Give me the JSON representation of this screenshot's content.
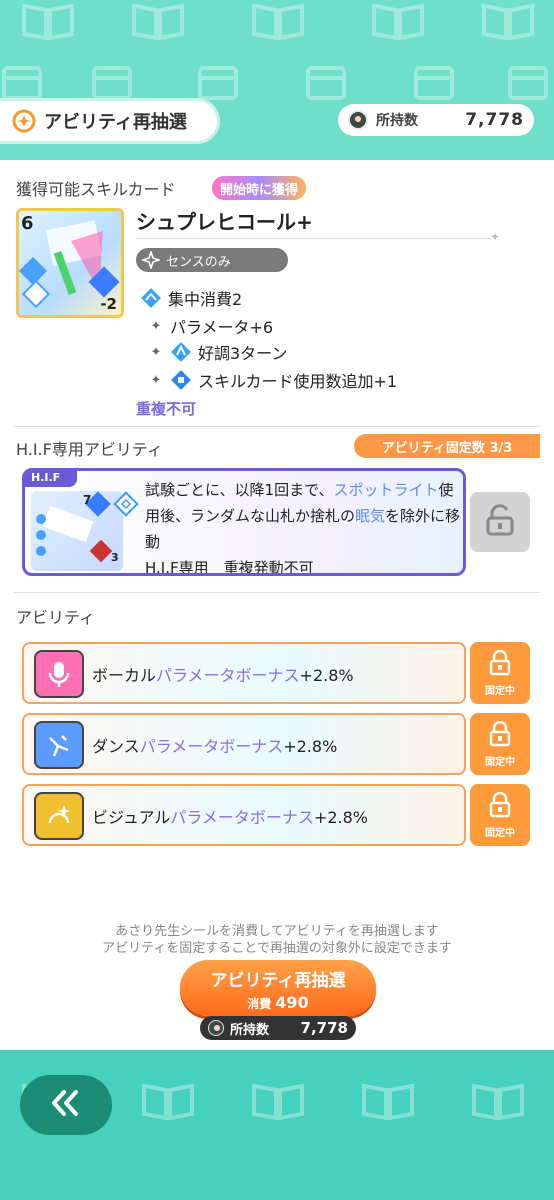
{
  "header": {
    "title": "アビリティ再抽選",
    "owned_label": "所持数",
    "owned_value": "7,778"
  },
  "skill_card": {
    "section_title": "獲得可能スキルカード",
    "badge": "開始時に獲得",
    "card_cost": "6",
    "card_modifier": "-2",
    "name": "シュプレヒコール+",
    "restriction": "センスのみ",
    "effects": [
      {
        "icon": "focus-cost-icon",
        "text": "集中消費2"
      },
      {
        "icon": "plus-icon",
        "text": "パラメータ+6"
      },
      {
        "icon": "good-condition-icon",
        "text": "好調3ターン"
      },
      {
        "icon": "card-use-icon",
        "text": "スキルカード使用数追加+1"
      }
    ],
    "no_duplicate": "重複不可"
  },
  "hif": {
    "section_title": "H.I.F専用アビリティ",
    "fixed_count": "アビリティ固定数 3/3",
    "tag": "H.I.F",
    "thumb_num": "7",
    "thumb_sub": "3",
    "desc_a": "試験ごとに、以降1回まで、",
    "desc_hl1": "スポットライト",
    "desc_b": "使用後、ランダムな山札か捨札の",
    "desc_hl2": "眠気",
    "desc_c": "を除外に移動",
    "footer": "H.I.F専用　重複発動不可"
  },
  "abilities": {
    "section_title": "アビリティ",
    "fixed_label": "固定中",
    "items": [
      {
        "icon": "vocal-icon",
        "prefix": "ボーカル",
        "highlight": "パラメータボーナス",
        "suffix": "+2.8%",
        "color": "#ff6fb4"
      },
      {
        "icon": "dance-icon",
        "prefix": "ダンス",
        "highlight": "パラメータボーナス",
        "suffix": "+2.8%",
        "color": "#5a9cff"
      },
      {
        "icon": "visual-icon",
        "prefix": "ビジュアル",
        "highlight": "パラメータボーナス",
        "suffix": "+2.8%",
        "color": "#f0c030"
      }
    ]
  },
  "footer": {
    "note1": "あさり先生シールを消費してアビリティを再抽選します",
    "note2": "アビリティを固定することで再抽選の対象外に設定できます",
    "reroll_label": "アビリティ再抽選",
    "cost_label": "消費",
    "cost_value": "490",
    "owned_label": "所持数",
    "owned_value": "7,778"
  },
  "colors": {
    "teal": "#4fd2b8",
    "orange": "#ff9845",
    "purple": "#6a5ad8"
  }
}
